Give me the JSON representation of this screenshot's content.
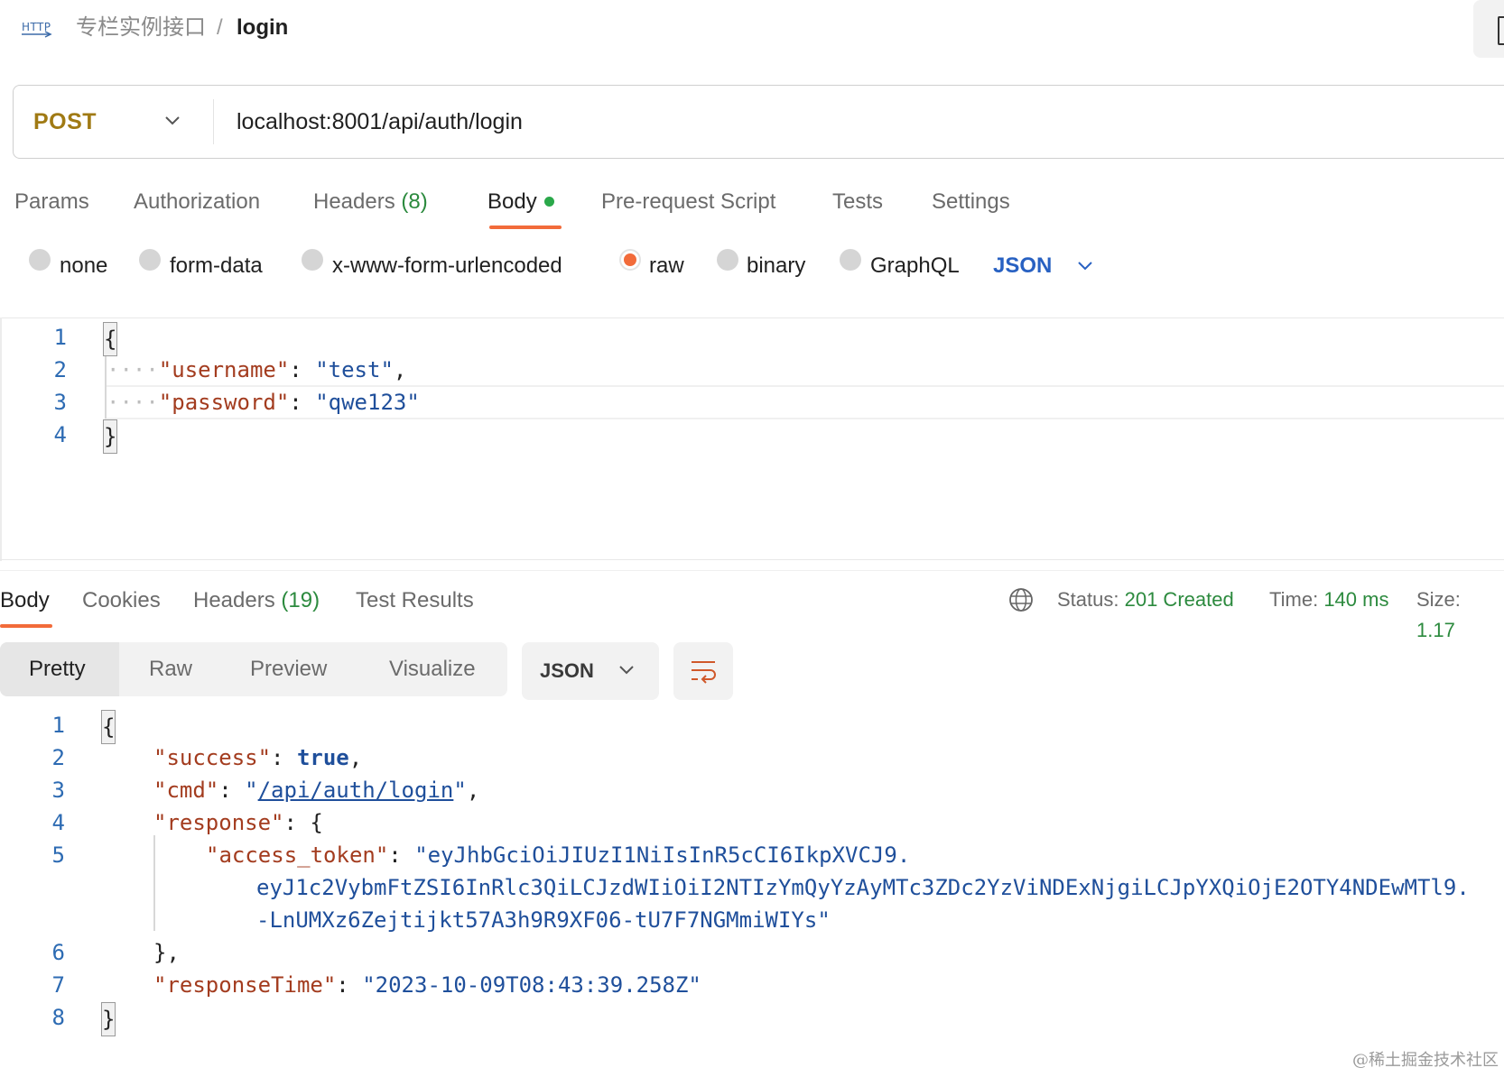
{
  "header": {
    "protocol_icon_label": "HTTP",
    "collection": "专栏实例接口",
    "separator": "/",
    "request_name": "login"
  },
  "request": {
    "method": "POST",
    "url": "localhost:8001/api/auth/login"
  },
  "request_tabs": [
    {
      "label": "Params"
    },
    {
      "label": "Authorization"
    },
    {
      "label": "Headers",
      "count": "(8)"
    },
    {
      "label": "Body",
      "active": true
    },
    {
      "label": "Pre-request Script"
    },
    {
      "label": "Tests"
    },
    {
      "label": "Settings"
    }
  ],
  "body_types": [
    {
      "label": "none",
      "selected": false
    },
    {
      "label": "form-data",
      "selected": false
    },
    {
      "label": "x-www-form-urlencoded",
      "selected": false
    },
    {
      "label": "raw",
      "selected": true
    },
    {
      "label": "binary",
      "selected": false
    },
    {
      "label": "GraphQL",
      "selected": false
    }
  ],
  "body_language": "JSON",
  "request_body": {
    "line_numbers": [
      "1",
      "2",
      "3",
      "4"
    ],
    "open_brace": "{",
    "close_brace": "}",
    "indent": "····",
    "fields": [
      {
        "key": "\"username\"",
        "value": "\"test\"",
        "trail": ","
      },
      {
        "key": "\"password\"",
        "value": "\"qwe123\"",
        "trail": ""
      }
    ]
  },
  "response_tabs": [
    {
      "label": "Body",
      "active": true
    },
    {
      "label": "Cookies"
    },
    {
      "label": "Headers",
      "count": "(19)"
    },
    {
      "label": "Test Results"
    }
  ],
  "status": {
    "status_label": "Status:",
    "status_value": "201 Created",
    "time_label": "Time:",
    "time_value": "140 ms",
    "size_label": "Size:",
    "size_value": "1.17"
  },
  "view_modes": [
    {
      "label": "Pretty",
      "active": true
    },
    {
      "label": "Raw"
    },
    {
      "label": "Preview"
    },
    {
      "label": "Visualize"
    }
  ],
  "response_format": "JSON",
  "response_body": {
    "line_numbers": [
      "1",
      "2",
      "3",
      "4",
      "5",
      "6",
      "7",
      "8"
    ],
    "open_brace": "{",
    "close_brace": "}",
    "success_key": "\"success\"",
    "success_value": "true",
    "cmd_key": "\"cmd\"",
    "cmd_value": "/api/auth/login",
    "response_key": "\"response\"",
    "access_token_key": "\"access_token\"",
    "access_token_line1": "\"eyJhbGciOiJIUzI1NiIsInR5cCI6IkpXVCJ9.",
    "access_token_line2": "eyJ1c2VybmFtZSI6InRlc3QiLCJzdWIiOiI2NTIzYmQyYzAyMTc3ZDc2YzViNDExNjgiLCJpYXQiOjE2OTY4NDEwMTl9.",
    "access_token_line3": "-LnUMXz6Zejtijkt57A3h9R9XF06-tU7F7NGMmiWIYs\"",
    "response_close": "},",
    "response_time_key": "\"responseTime\"",
    "response_time_value": "\"2023-10-09T08:43:39.258Z\""
  },
  "watermark": "@稀土掘金技术社区",
  "colors": {
    "accent": "#f26b3a",
    "method": "#a07a14",
    "status_ok": "#2c8a3e",
    "string": "#a33c1f",
    "value": "#1f4f9b"
  },
  "icons": [
    "http-icon",
    "chevron-down-icon",
    "globe-icon",
    "wrap-lines-icon"
  ]
}
